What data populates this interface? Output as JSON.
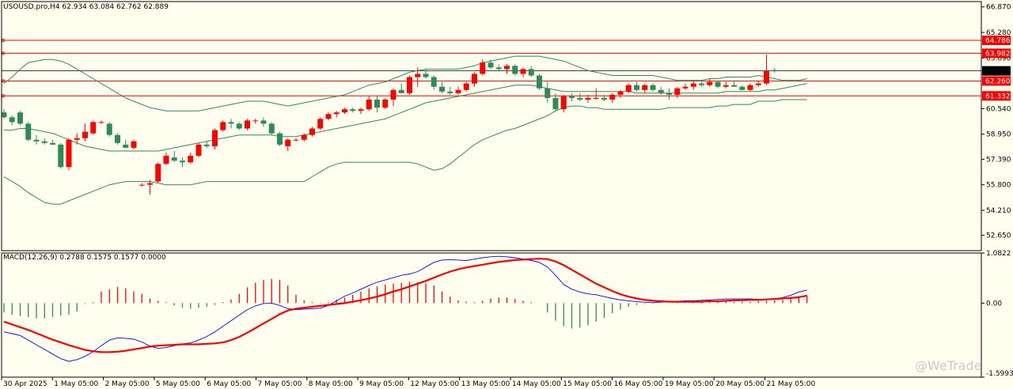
{
  "chart_data": [
    {
      "type": "candlestick",
      "symbol_header": "USOUSD.pro,H4  62.934 63.084 62.762 62.889",
      "ylim": [
        51.7,
        67.2
      ],
      "y_ticks": [
        "66.870",
        "65.280",
        "63.690",
        "60.540",
        "58.950",
        "57.390",
        "55.800",
        "54.210",
        "52.650"
      ],
      "horizontal_lines": [
        {
          "value": 64.786,
          "label": "64.786",
          "color": "#ff0000"
        },
        {
          "value": 63.982,
          "label": "63.982",
          "color": "#ff0000"
        },
        {
          "value": 62.26,
          "label": "62.260",
          "color": "#ff0000"
        },
        {
          "value": 61.332,
          "label": "61.332",
          "color": "#ff0000"
        }
      ],
      "current_price": {
        "value": 62.889,
        "label": "62.889"
      },
      "x_labels": [
        "30 Apr 2025",
        "1 May 05:00",
        "2 May 05:00",
        "5 May 05:00",
        "6 May 05:00",
        "7 May 05:00",
        "8 May 05:00",
        "9 May 05:00",
        "12 May 05:00",
        "13 May 05:00",
        "14 May 05:00",
        "15 May 05:00",
        "16 May 05:00",
        "19 May 05:00",
        "20 May 05:00",
        "21 May 05:00"
      ],
      "colors": {
        "bull": "#ff0000",
        "bear": "#2e8b57",
        "band": "#2e8b57",
        "grid": "#000000",
        "bg": "#fffff0"
      },
      "candles": [
        [
          60.3,
          60.5,
          59.9,
          60.0
        ],
        [
          60.0,
          60.1,
          59.5,
          59.7
        ],
        [
          60.3,
          60.4,
          59.5,
          59.6
        ],
        [
          59.6,
          59.7,
          58.5,
          58.6
        ],
        [
          58.6,
          58.9,
          58.3,
          58.5
        ],
        [
          58.5,
          58.7,
          58.3,
          58.4
        ],
        [
          58.4,
          58.6,
          58.3,
          58.3
        ],
        [
          58.3,
          58.4,
          56.8,
          56.9
        ],
        [
          56.9,
          58.7,
          56.7,
          58.6
        ],
        [
          58.6,
          59.0,
          58.3,
          58.7
        ],
        [
          58.7,
          59.6,
          58.5,
          59.1
        ],
        [
          59.0,
          59.8,
          58.9,
          59.7
        ],
        [
          59.7,
          59.8,
          59.6,
          59.7
        ],
        [
          59.6,
          59.7,
          58.8,
          58.9
        ],
        [
          58.9,
          59.0,
          58.3,
          58.4
        ],
        [
          58.3,
          58.6,
          58.1,
          58.1
        ],
        [
          58.1,
          58.6,
          58.0,
          58.5
        ],
        [
          55.8,
          55.9,
          55.7,
          55.8
        ],
        [
          55.8,
          56.1,
          55.2,
          55.9
        ],
        [
          56.0,
          57.2,
          55.9,
          57.1
        ],
        [
          57.1,
          57.8,
          57.0,
          57.6
        ],
        [
          57.5,
          57.9,
          57.2,
          57.3
        ],
        [
          57.3,
          57.5,
          56.9,
          57.2
        ],
        [
          57.2,
          57.8,
          57.1,
          57.6
        ],
        [
          57.6,
          58.4,
          57.5,
          58.3
        ],
        [
          58.3,
          58.5,
          58.1,
          58.2
        ],
        [
          58.2,
          59.3,
          58.0,
          59.2
        ],
        [
          59.2,
          59.8,
          59.1,
          59.7
        ],
        [
          59.7,
          59.9,
          59.3,
          59.6
        ],
        [
          59.6,
          59.7,
          59.2,
          59.3
        ],
        [
          59.3,
          59.9,
          59.2,
          59.8
        ],
        [
          59.8,
          59.9,
          59.6,
          59.8
        ],
        [
          59.8,
          60.0,
          59.4,
          59.6
        ],
        [
          59.6,
          59.7,
          58.9,
          59.0
        ],
        [
          59.0,
          59.1,
          58.2,
          58.3
        ],
        [
          58.2,
          58.7,
          57.9,
          58.6
        ],
        [
          58.6,
          58.7,
          58.5,
          58.6
        ],
        [
          58.6,
          59.0,
          58.5,
          58.9
        ],
        [
          58.9,
          59.4,
          58.8,
          59.3
        ],
        [
          59.3,
          60.0,
          59.2,
          59.9
        ],
        [
          59.9,
          60.3,
          59.8,
          60.2
        ],
        [
          60.2,
          60.4,
          60.0,
          60.3
        ],
        [
          60.3,
          60.6,
          60.2,
          60.5
        ],
        [
          60.5,
          60.6,
          60.3,
          60.4
        ],
        [
          60.4,
          60.6,
          60.2,
          60.5
        ],
        [
          60.5,
          61.3,
          60.4,
          61.1
        ],
        [
          61.1,
          61.3,
          60.3,
          60.6
        ],
        [
          60.6,
          61.2,
          60.5,
          61.1
        ],
        [
          61.1,
          61.8,
          60.7,
          61.7
        ],
        [
          61.7,
          62.1,
          61.5,
          61.5
        ],
        [
          61.5,
          62.6,
          61.4,
          62.5
        ],
        [
          62.5,
          63.1,
          61.9,
          62.7
        ],
        [
          62.7,
          63.0,
          62.4,
          62.5
        ],
        [
          62.5,
          62.6,
          61.7,
          61.9
        ],
        [
          61.9,
          62.2,
          61.5,
          61.6
        ],
        [
          61.6,
          61.9,
          61.4,
          61.5
        ],
        [
          61.5,
          61.9,
          61.4,
          61.7
        ],
        [
          61.7,
          62.2,
          61.6,
          62.1
        ],
        [
          62.1,
          62.8,
          61.9,
          62.7
        ],
        [
          62.7,
          63.6,
          62.6,
          63.4
        ],
        [
          63.4,
          63.6,
          63.0,
          63.1
        ],
        [
          63.1,
          63.3,
          62.9,
          63.0
        ],
        [
          63.0,
          63.3,
          62.7,
          63.2
        ],
        [
          63.2,
          63.3,
          62.6,
          62.7
        ],
        [
          62.7,
          63.1,
          62.5,
          63.0
        ],
        [
          63.0,
          63.2,
          62.5,
          62.6
        ],
        [
          62.6,
          62.7,
          61.7,
          61.8
        ],
        [
          61.8,
          62.2,
          60.9,
          61.2
        ],
        [
          61.2,
          61.5,
          60.4,
          60.5
        ],
        [
          60.5,
          61.4,
          60.3,
          61.3
        ],
        [
          61.3,
          61.5,
          61.0,
          61.2
        ],
        [
          61.2,
          61.5,
          61.0,
          61.1
        ],
        [
          61.1,
          61.4,
          60.9,
          61.2
        ],
        [
          61.2,
          61.8,
          61.1,
          61.2
        ],
        [
          61.2,
          61.4,
          61.0,
          61.1
        ],
        [
          61.1,
          61.5,
          60.9,
          61.4
        ],
        [
          61.4,
          61.7,
          61.2,
          61.6
        ],
        [
          61.6,
          62.1,
          61.5,
          62.0
        ],
        [
          62.0,
          62.2,
          61.6,
          61.7
        ],
        [
          61.7,
          62.1,
          61.5,
          62.0
        ],
        [
          62.0,
          62.1,
          61.6,
          61.7
        ],
        [
          61.7,
          61.9,
          61.4,
          61.5
        ],
        [
          61.5,
          61.8,
          61.1,
          61.4
        ],
        [
          61.4,
          61.9,
          61.2,
          61.8
        ],
        [
          61.8,
          62.1,
          61.7,
          61.9
        ],
        [
          61.9,
          62.3,
          61.7,
          62.1
        ],
        [
          62.1,
          62.2,
          61.9,
          62.0
        ],
        [
          62.0,
          62.4,
          61.9,
          62.2
        ],
        [
          62.2,
          62.3,
          61.8,
          61.9
        ],
        [
          61.9,
          62.2,
          61.8,
          62.0
        ],
        [
          62.0,
          62.3,
          61.9,
          61.9
        ],
        [
          61.9,
          62.0,
          61.7,
          61.7
        ],
        [
          61.7,
          62.1,
          61.6,
          62.0
        ],
        [
          62.0,
          62.3,
          61.9,
          62.1
        ],
        [
          62.1,
          63.9,
          62.0,
          62.9
        ],
        [
          62.934,
          63.084,
          62.762,
          62.889
        ]
      ],
      "bb_upper": [
        62.1,
        62.5,
        63.0,
        63.4,
        63.5,
        63.6,
        63.6,
        63.5,
        63.3,
        63.0,
        62.7,
        62.4,
        62.1,
        61.8,
        61.5,
        61.2,
        61.0,
        60.8,
        60.6,
        60.5,
        60.4,
        60.4,
        60.4,
        60.4,
        60.4,
        60.5,
        60.6,
        60.7,
        60.8,
        60.9,
        61.0,
        61.0,
        61.0,
        60.9,
        60.8,
        60.7,
        60.8,
        60.9,
        61.0,
        61.1,
        61.2,
        61.3,
        61.4,
        61.6,
        61.8,
        62.0,
        62.1,
        62.2,
        62.4,
        62.6,
        62.8,
        62.9,
        63.0,
        63.0,
        63.0,
        63.0,
        63.0,
        63.1,
        63.2,
        63.4,
        63.5,
        63.6,
        63.7,
        63.8,
        63.8,
        63.8,
        63.8,
        63.7,
        63.6,
        63.5,
        63.3,
        63.1,
        62.9,
        62.8,
        62.7,
        62.6,
        62.6,
        62.6,
        62.6,
        62.6,
        62.6,
        62.5,
        62.4,
        62.3,
        62.3,
        62.3,
        62.3,
        62.4,
        62.4,
        62.5,
        62.5,
        62.5,
        62.5,
        62.6,
        62.5,
        62.4,
        62.3,
        62.3,
        62.3,
        62.4
      ],
      "bb_mid": [
        59.2,
        59.2,
        59.3,
        59.3,
        59.2,
        59.1,
        59.0,
        58.8,
        58.6,
        58.4,
        58.2,
        58.1,
        58.0,
        57.9,
        57.9,
        57.9,
        57.9,
        57.9,
        57.9,
        57.9,
        58.0,
        58.1,
        58.2,
        58.3,
        58.4,
        58.5,
        58.6,
        58.7,
        58.8,
        58.9,
        58.9,
        58.9,
        58.9,
        58.9,
        58.8,
        58.8,
        58.8,
        58.9,
        59.0,
        59.1,
        59.2,
        59.3,
        59.4,
        59.5,
        59.6,
        59.7,
        59.8,
        59.9,
        60.1,
        60.3,
        60.5,
        60.7,
        60.9,
        61.0,
        61.1,
        61.2,
        61.3,
        61.4,
        61.5,
        61.6,
        61.7,
        61.8,
        61.9,
        62.0,
        62.0,
        62.0,
        61.9,
        61.8,
        61.7,
        61.6,
        61.6,
        61.6,
        61.6,
        61.6,
        61.6,
        61.6,
        61.6,
        61.6,
        61.5,
        61.5,
        61.5,
        61.5,
        61.5,
        61.5,
        61.5,
        61.5,
        61.5,
        61.5,
        61.5,
        61.6,
        61.6,
        61.6,
        61.6,
        61.6,
        61.7,
        61.7,
        61.8,
        61.9,
        62.0,
        62.1
      ],
      "bb_lower": [
        56.3,
        56.0,
        55.7,
        55.3,
        55.0,
        54.7,
        54.6,
        54.6,
        54.8,
        55.0,
        55.2,
        55.4,
        55.6,
        55.8,
        55.9,
        56.0,
        56.0,
        56.0,
        56.0,
        55.9,
        55.8,
        55.8,
        55.8,
        55.8,
        55.9,
        56.0,
        56.0,
        56.0,
        56.0,
        56.0,
        56.0,
        56.0,
        56.0,
        56.0,
        56.0,
        56.0,
        56.0,
        56.0,
        56.3,
        56.6,
        56.9,
        57.1,
        57.2,
        57.2,
        57.2,
        57.2,
        57.2,
        57.2,
        57.2,
        57.2,
        57.2,
        57.1,
        56.9,
        56.7,
        56.8,
        57.1,
        57.5,
        57.9,
        58.3,
        58.6,
        58.8,
        59.0,
        59.2,
        59.3,
        59.5,
        59.7,
        59.9,
        60.1,
        60.4,
        60.6,
        60.7,
        60.7,
        60.6,
        60.6,
        60.5,
        60.5,
        60.5,
        60.5,
        60.5,
        60.5,
        60.5,
        60.5,
        60.6,
        60.6,
        60.6,
        60.6,
        60.6,
        60.6,
        60.7,
        60.7,
        60.8,
        60.8,
        60.8,
        61.0,
        61.0,
        61.0,
        61.1,
        61.1,
        61.1,
        61.1
      ]
    },
    {
      "type": "macd",
      "title": "MACD(12,26,9) 0.2788 0.1575 0.1577 0.0000",
      "ylim": [
        -1.5993,
        1.0822
      ],
      "y_ticks": [
        "1.0822",
        "0.00",
        "-1.5993"
      ],
      "histogram": [
        -0.2,
        -0.25,
        -0.28,
        -0.3,
        -0.33,
        -0.33,
        -0.3,
        -0.27,
        -0.25,
        -0.18,
        -0.02,
        0.02,
        0.25,
        0.3,
        0.35,
        0.32,
        0.25,
        0.2,
        0.1,
        0.05,
        0.02,
        -0.05,
        -0.1,
        -0.12,
        -0.1,
        -0.08,
        -0.04,
        0.02,
        0.08,
        0.2,
        0.34,
        0.44,
        0.5,
        0.52,
        0.5,
        0.38,
        0.18,
        0.06,
        0.02,
        0.01,
        0.02,
        0.07,
        0.12,
        0.18,
        0.25,
        0.32,
        0.36,
        0.4,
        0.42,
        0.44,
        0.46,
        0.45,
        0.43,
        0.38,
        0.25,
        0.14,
        0.06,
        0.03,
        0.02,
        0.05,
        0.1,
        0.12,
        0.12,
        0.09,
        0.05,
        0.02,
        0.0,
        -0.2,
        -0.38,
        -0.5,
        -0.55,
        -0.53,
        -0.48,
        -0.4,
        -0.32,
        -0.22,
        -0.14,
        -0.08,
        -0.04,
        -0.02,
        -0.01,
        0.0,
        0.0,
        0.01,
        0.01,
        0.02,
        0.02,
        0.02,
        0.03,
        0.03,
        0.03,
        0.03,
        0.03,
        0.04,
        0.05,
        0.06,
        0.07,
        0.09,
        0.12,
        0.16
      ],
      "macd_line": [
        -0.62,
        -0.66,
        -0.7,
        -0.8,
        -0.9,
        -1.0,
        -1.1,
        -1.2,
        -1.26,
        -1.22,
        -1.15,
        -1.05,
        -0.92,
        -0.8,
        -0.75,
        -0.76,
        -0.78,
        -0.84,
        -0.93,
        -0.98,
        -0.96,
        -0.92,
        -0.88,
        -0.86,
        -0.8,
        -0.72,
        -0.62,
        -0.5,
        -0.38,
        -0.26,
        -0.14,
        -0.06,
        -0.01,
        0.0,
        -0.05,
        -0.12,
        -0.14,
        -0.13,
        -0.12,
        -0.11,
        -0.05,
        0.05,
        0.15,
        0.22,
        0.3,
        0.38,
        0.45,
        0.5,
        0.55,
        0.6,
        0.63,
        0.68,
        0.78,
        0.88,
        0.93,
        0.94,
        0.93,
        0.92,
        0.95,
        0.98,
        1.0,
        1.01,
        1.0,
        0.98,
        0.95,
        0.92,
        0.88,
        0.78,
        0.6,
        0.4,
        0.3,
        0.24,
        0.2,
        0.18,
        0.14,
        0.1,
        0.07,
        0.05,
        0.03,
        0.02,
        0.01,
        0.02,
        0.03,
        0.04,
        0.05,
        0.05,
        0.06,
        0.07,
        0.08,
        0.09,
        0.09,
        0.09,
        0.09,
        0.08,
        0.08,
        0.09,
        0.12,
        0.17,
        0.24,
        0.28
      ],
      "signal_line": [
        -0.4,
        -0.46,
        -0.52,
        -0.58,
        -0.65,
        -0.72,
        -0.79,
        -0.85,
        -0.91,
        -0.96,
        -1.01,
        -1.04,
        -1.06,
        -1.06,
        -1.05,
        -1.03,
        -1.0,
        -0.97,
        -0.94,
        -0.92,
        -0.91,
        -0.9,
        -0.89,
        -0.89,
        -0.89,
        -0.88,
        -0.87,
        -0.85,
        -0.8,
        -0.73,
        -0.64,
        -0.54,
        -0.44,
        -0.34,
        -0.24,
        -0.16,
        -0.12,
        -0.1,
        -0.08,
        -0.06,
        -0.04,
        -0.02,
        0.0,
        0.03,
        0.06,
        0.1,
        0.14,
        0.19,
        0.25,
        0.3,
        0.36,
        0.42,
        0.48,
        0.55,
        0.62,
        0.68,
        0.73,
        0.77,
        0.8,
        0.83,
        0.86,
        0.89,
        0.91,
        0.93,
        0.94,
        0.95,
        0.96,
        0.95,
        0.9,
        0.82,
        0.72,
        0.62,
        0.52,
        0.42,
        0.34,
        0.26,
        0.19,
        0.14,
        0.1,
        0.07,
        0.05,
        0.04,
        0.03,
        0.03,
        0.03,
        0.03,
        0.03,
        0.04,
        0.04,
        0.05,
        0.06,
        0.06,
        0.07,
        0.07,
        0.08,
        0.09,
        0.1,
        0.11,
        0.13,
        0.16
      ]
    }
  ],
  "watermark": "@WeTrade"
}
